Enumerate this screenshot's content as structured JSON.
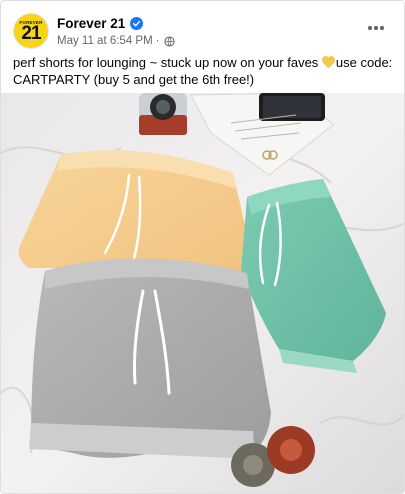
{
  "post": {
    "page_name": "Forever 21",
    "avatar_top": "FOREVER",
    "avatar_number": "21",
    "timestamp": "May 11 at 6:54 PM",
    "separator": "·",
    "caption_part1": "perf shorts for lounging ~ stuck up now on your faves ",
    "caption_part2": "use code: CARTPARTY (buy 5 and get the 6th free!)",
    "icons": {
      "verified": "verified-badge-icon",
      "audience": "globe-icon",
      "menu": "more-options-icon",
      "emoji": "yellow-heart-icon"
    },
    "colors": {
      "verified": "#1877f2",
      "meta_text": "#65676b",
      "avatar_bg": "#f7d417",
      "heart": "#f7c948"
    }
  }
}
